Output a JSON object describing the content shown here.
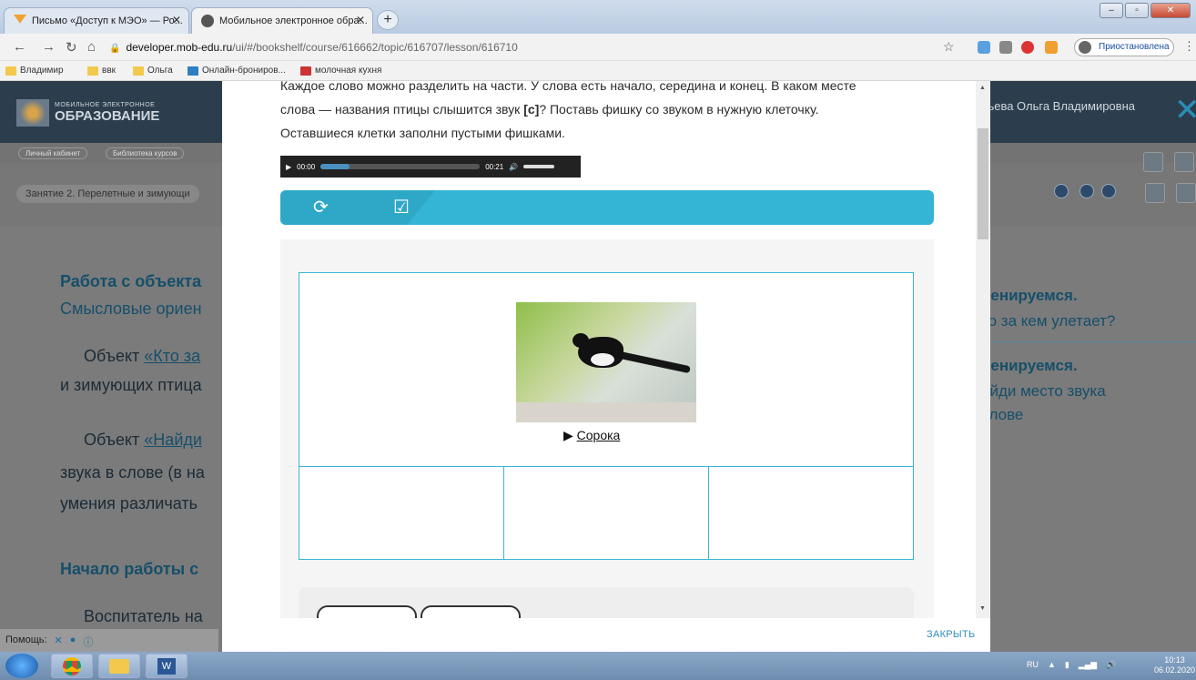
{
  "tabs": [
    {
      "title": "Письмо «Доступ к МЭО» — Ро..."
    },
    {
      "title": "Мобильное электронное обра..."
    }
  ],
  "address_bar": {
    "host": "developer.mob-edu.ru",
    "path": "/ui/#/bookshelf/course/616662/topic/616707/lesson/616710"
  },
  "profile_status": "Приостановлена",
  "bookmarks": [
    "Владимир",
    "ввк",
    "Ольга",
    "Онлайн-брониров...",
    "молочная кухня"
  ],
  "site": {
    "logo_line1": "МОБИЛЬНОЕ ЭЛЕКТРОННОЕ",
    "logo_line2": "ОБРАЗОВАНИЕ",
    "user_name": "бьева Ольга Владимировна",
    "user_sub": "ы]",
    "breadcrumbs": [
      "Личный кабинет",
      "Библиотека курсов"
    ],
    "lesson_title": "Занятие 2. Перелетные и зимующи",
    "help_label": "Помощь:"
  },
  "background_text": {
    "h1": "Работа с объекта",
    "h1_sub": "Смысловые ориен",
    "p1_prefix": "Объект ",
    "p1_link": "«Кто за",
    "p1_line2": "и зимующих птица",
    "p2_prefix": "Объект ",
    "p2_link": "«Найди",
    "p2_line2": "звука в слове (в на",
    "p2_line3": "умения различать",
    "h2": "Начало работы с",
    "p3": "Воспитатель на",
    "right1_h": "ренируемся.",
    "right1_s": "то за кем улетает?",
    "right2_h": "ренируемся.",
    "right2_s1": "айди место звука",
    "right2_s2": "слове"
  },
  "modal": {
    "instruction_line0": "Каждое слово можно разделить на части. У слова есть начало, середина и конец. В каком месте",
    "instruction_line1_pre": "слова — названия птицы слышится звук ",
    "instruction_sound": "[с]",
    "instruction_line1_post": "? Поставь фишку со звуком в нужную клеточку.",
    "instruction_line2": "Оставшиеся клетки заполни пустыми фишками.",
    "audio": {
      "current": "00:00",
      "duration": "00:21",
      "progress": 0.18
    },
    "picture_caption": "Сорока",
    "close_label": "ЗАКРЫТЬ"
  },
  "taskbar": {
    "lang": "RU",
    "time": "10:13",
    "date": "06.02.2020"
  }
}
